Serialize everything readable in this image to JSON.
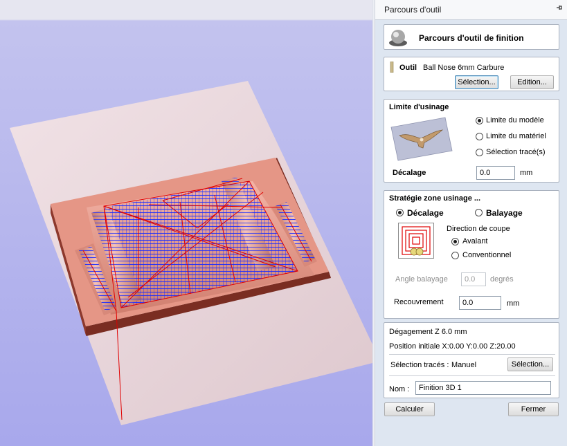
{
  "panel": {
    "title": "Parcours d'outil",
    "header_title": "Parcours d'outil de finition"
  },
  "tool": {
    "label": "Outil",
    "name": "Ball Nose 6mm Carbure",
    "select_button": "Sélection...",
    "edit_button": "Edition..."
  },
  "machining_limit": {
    "title": "Limite d'usinage",
    "options": [
      "Limite du modèle",
      "Limite du matériel",
      "Sélection tracé(s)"
    ],
    "selected_index": 0,
    "offset_label": "Décalage",
    "offset_value": "0.0",
    "offset_unit": "mm"
  },
  "strategy": {
    "title": "Stratégie zone usinage ...",
    "offset_option": "Décalage",
    "raster_option": "Balayage",
    "selected": "Décalage",
    "cut_direction_label": "Direction de coupe",
    "climb": "Avalant",
    "conventional": "Conventionnel",
    "cut_selected": "Avalant",
    "raster_angle_label": "Angle balayage",
    "raster_angle_value": "0.0",
    "raster_angle_unit": "degrés",
    "stepover_label": "Recouvrement",
    "stepover_value": "0.0",
    "stepover_unit": "mm"
  },
  "settings": {
    "safe_z": "Dégagement Z  6.0 mm",
    "home_position": "Position initiale  X:0.00 Y:0.00 Z:20.00",
    "vector_selection_label": "Sélection tracés :",
    "vector_selection_value": "Manuel",
    "vector_selection_button": "Sélection...",
    "name_label": "Nom :",
    "name_value": "Finition 3D 1"
  },
  "footer": {
    "calculate": "Calculer",
    "close": "Fermer"
  },
  "colors": {
    "viewport_bg": "#a8a8ec",
    "toolpath_blue": "#1a2cff",
    "toolpath_red": "#e00000",
    "material": "#e59686",
    "panel_bg": "#dee6f1"
  }
}
